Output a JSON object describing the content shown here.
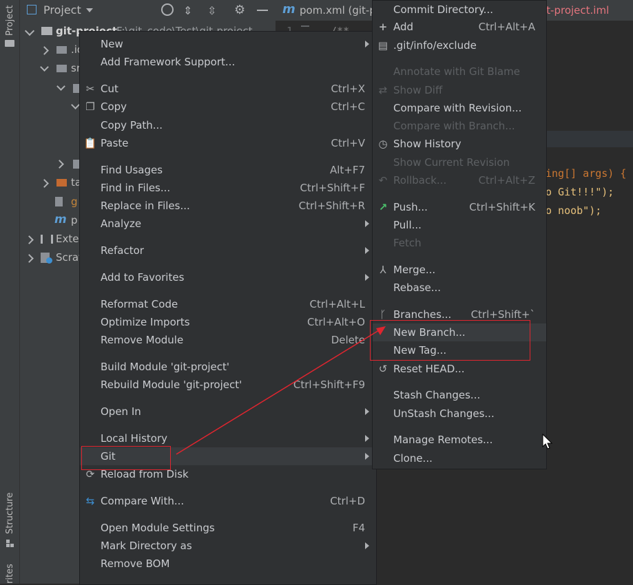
{
  "toolstrip": {
    "project_label": "Project",
    "structure_label": "Structure",
    "favorites_label": "rites"
  },
  "project_panel": {
    "title": "Project",
    "tree": [
      {
        "label": "git-project",
        "path": "F:\\git_code\\Test\\git-project"
      },
      {
        "label": ".id"
      },
      {
        "label": "sr"
      },
      {
        "label": ""
      },
      {
        "label": ""
      },
      {
        "label": ""
      },
      {
        "label": "ta"
      },
      {
        "label": "g"
      },
      {
        "label": "p"
      },
      {
        "label": "Exter"
      },
      {
        "label": "Scrat"
      }
    ]
  },
  "editor": {
    "tabs": [
      {
        "label": "pom.xml (git-p"
      },
      {
        "label": "it-project.iml"
      }
    ],
    "gutter": {
      "line_number": "1",
      "comment": "/**"
    },
    "code_lines": [
      {
        "text": "ing[] args) {"
      },
      {
        "text": "o Git!!!\");"
      },
      {
        "text": "o noob\");"
      }
    ]
  },
  "context_menu": {
    "items": [
      {
        "label": "New",
        "shortcut": "",
        "submenu": true,
        "icon": ""
      },
      {
        "label": "Add Framework Support...",
        "shortcut": "",
        "icon": ""
      },
      {
        "label": "Cut",
        "shortcut": "Ctrl+X",
        "icon": "scissors-icon"
      },
      {
        "label": "Copy",
        "shortcut": "Ctrl+C",
        "icon": "copy-icon"
      },
      {
        "label": "Copy Path...",
        "shortcut": "",
        "icon": ""
      },
      {
        "label": "Paste",
        "shortcut": "Ctrl+V",
        "icon": "paste-icon"
      },
      {
        "label": "Find Usages",
        "shortcut": "Alt+F7",
        "icon": ""
      },
      {
        "label": "Find in Files...",
        "shortcut": "Ctrl+Shift+F",
        "icon": ""
      },
      {
        "label": "Replace in Files...",
        "shortcut": "Ctrl+Shift+R",
        "icon": ""
      },
      {
        "label": "Analyze",
        "shortcut": "",
        "submenu": true,
        "icon": ""
      },
      {
        "label": "Refactor",
        "shortcut": "",
        "submenu": true,
        "icon": ""
      },
      {
        "label": "Add to Favorites",
        "shortcut": "",
        "submenu": true,
        "icon": ""
      },
      {
        "label": "Reformat Code",
        "shortcut": "Ctrl+Alt+L",
        "icon": ""
      },
      {
        "label": "Optimize Imports",
        "shortcut": "Ctrl+Alt+O",
        "icon": ""
      },
      {
        "label": "Remove Module",
        "shortcut": "Delete",
        "icon": ""
      },
      {
        "label": "Build Module 'git-project'",
        "shortcut": "",
        "icon": ""
      },
      {
        "label": "Rebuild Module 'git-project'",
        "shortcut": "Ctrl+Shift+F9",
        "icon": ""
      },
      {
        "label": "Open In",
        "shortcut": "",
        "submenu": true,
        "icon": ""
      },
      {
        "label": "Local History",
        "shortcut": "",
        "submenu": true,
        "icon": ""
      },
      {
        "label": "Git",
        "shortcut": "",
        "submenu": true,
        "icon": ""
      },
      {
        "label": "Reload from Disk",
        "shortcut": "",
        "icon": "reload-icon"
      },
      {
        "label": "Compare With...",
        "shortcut": "Ctrl+D",
        "icon": "compare-icon"
      },
      {
        "label": "Open Module Settings",
        "shortcut": "F4",
        "icon": ""
      },
      {
        "label": "Mark Directory as",
        "shortcut": "",
        "submenu": true,
        "icon": ""
      },
      {
        "label": "Remove BOM",
        "shortcut": "",
        "icon": ""
      }
    ]
  },
  "git_menu": {
    "items": [
      {
        "label": "Commit Directory...",
        "shortcut": "",
        "icon": ""
      },
      {
        "label": "Add",
        "shortcut": "Ctrl+Alt+A",
        "icon": "plus-icon"
      },
      {
        "label": ".git/info/exclude",
        "shortcut": "",
        "icon": "git-file-icon"
      },
      {
        "label": "Annotate with Git Blame",
        "shortcut": "",
        "disabled": true,
        "icon": ""
      },
      {
        "label": "Show Diff",
        "shortcut": "",
        "disabled": true,
        "icon": "diff-icon"
      },
      {
        "label": "Compare with Revision...",
        "shortcut": "",
        "icon": ""
      },
      {
        "label": "Compare with Branch...",
        "shortcut": "",
        "disabled": true,
        "icon": ""
      },
      {
        "label": "Show History",
        "shortcut": "",
        "icon": "clock-icon"
      },
      {
        "label": "Show Current Revision",
        "shortcut": "",
        "disabled": true,
        "icon": ""
      },
      {
        "label": "Rollback...",
        "shortcut": "Ctrl+Alt+Z",
        "disabled": true,
        "icon": "rollback-icon"
      },
      {
        "label": "Push...",
        "shortcut": "Ctrl+Shift+K",
        "icon": "push-arrow-icon"
      },
      {
        "label": "Pull...",
        "shortcut": "",
        "icon": ""
      },
      {
        "label": "Fetch",
        "shortcut": "",
        "disabled": true,
        "icon": ""
      },
      {
        "label": "Merge...",
        "shortcut": "",
        "icon": "merge-icon"
      },
      {
        "label": "Rebase...",
        "shortcut": "",
        "icon": ""
      },
      {
        "label": "Branches...",
        "shortcut": "Ctrl+Shift+`",
        "icon": "branch-icon"
      },
      {
        "label": "New Branch...",
        "shortcut": "",
        "icon": ""
      },
      {
        "label": "New Tag...",
        "shortcut": "",
        "icon": ""
      },
      {
        "label": "Reset HEAD...",
        "shortcut": "",
        "icon": "reset-icon"
      },
      {
        "label": "Stash Changes...",
        "shortcut": "",
        "icon": ""
      },
      {
        "label": "UnStash Changes...",
        "shortcut": "",
        "icon": ""
      },
      {
        "label": "Manage Remotes...",
        "shortcut": "",
        "icon": ""
      },
      {
        "label": "Clone...",
        "shortcut": "",
        "icon": ""
      }
    ]
  },
  "colors": {
    "menu_bg": "#2f3133",
    "text": "#c9cbcf",
    "disabled": "#5d6063",
    "highlight": "#e0252f",
    "code_orange": "#cc7832",
    "code_string": "#e6c07b"
  }
}
